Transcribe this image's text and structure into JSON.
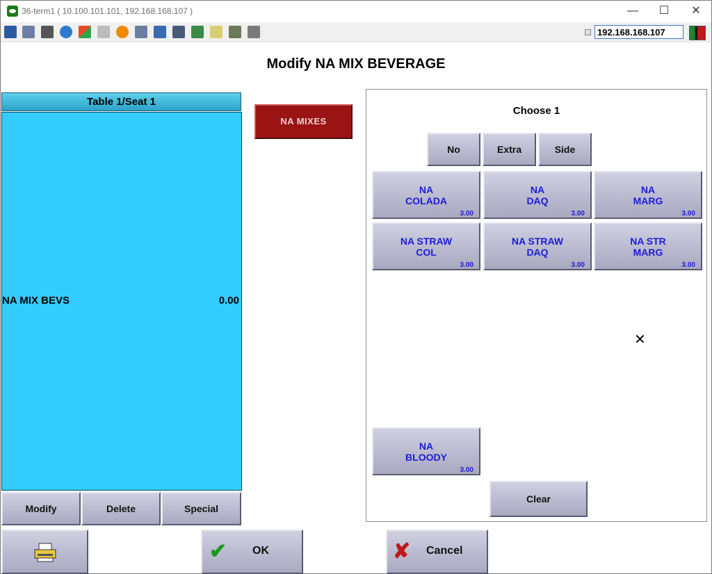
{
  "window": {
    "title": "36-term1 ( 10.100.101.101, 192.168.168.107 )",
    "minimize": "—",
    "maximize": "☐",
    "close": "✕"
  },
  "toolbar": {
    "ip_address": "192.168.168.107",
    "icons": [
      "monitor-icon",
      "windows-icon",
      "tools-icon",
      "refresh-icon",
      "windows-logo-icon",
      "keyboard-icon",
      "alert-icon",
      "network-icon",
      "fullscreen-icon",
      "display-icon",
      "transfer-icon",
      "notepad-icon",
      "screenshot-icon",
      "chat-icon"
    ]
  },
  "page": {
    "title": "Modify NA MIX BEVERAGE"
  },
  "order": {
    "header": "Table 1/Seat 1",
    "items": [
      {
        "name": "NA MIX BEVS",
        "price": "0.00"
      }
    ],
    "buttons": {
      "modify": "Modify",
      "delete": "Delete",
      "special": "Special"
    }
  },
  "category": {
    "label": "NA MIXES"
  },
  "modifiers": {
    "choose_label": "Choose 1",
    "prefix_buttons": {
      "no": "No",
      "extra": "Extra",
      "side": "Side"
    },
    "items": [
      {
        "line1": "NA",
        "line2": "COLADA",
        "price": "3.00"
      },
      {
        "line1": "NA",
        "line2": "DAQ",
        "price": "3.00"
      },
      {
        "line1": "NA",
        "line2": "MARG",
        "price": "3.00"
      },
      {
        "line1": "NA STRAW",
        "line2": "COL",
        "price": "3.00"
      },
      {
        "line1": "NA STRAW",
        "line2": "DAQ",
        "price": "3.00"
      },
      {
        "line1": "NA STR",
        "line2": "MARG",
        "price": "3.00"
      },
      {
        "line1": "NA",
        "line2": "BLOODY",
        "price": "3.00"
      }
    ],
    "clear": "Clear"
  },
  "footer": {
    "ok": "OK",
    "cancel": "Cancel"
  },
  "colors": {
    "order_panel": "#33ccff",
    "category_button": "#9b1414",
    "modifier_text": "#1c1cd6"
  }
}
